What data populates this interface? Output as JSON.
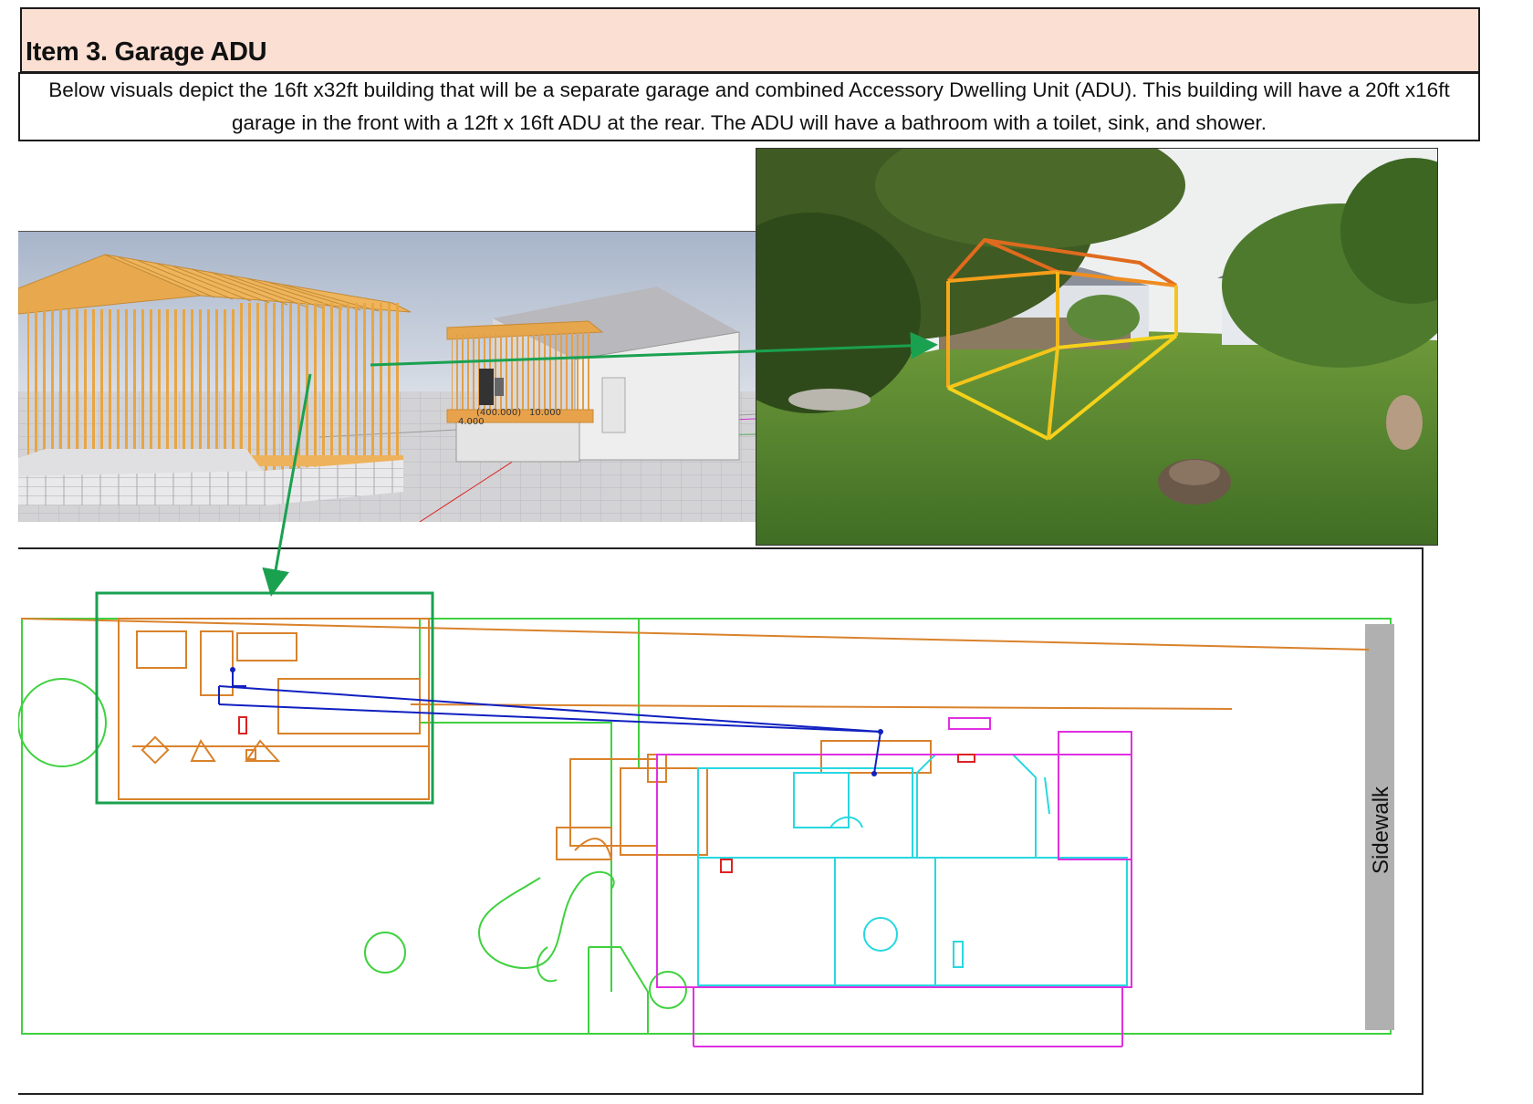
{
  "header": {
    "title": "Item 3. Garage ADU",
    "description": "Below visuals depict the 16ft x32ft  building that will be a separate garage and combined Accessory Dwelling Unit (ADU). This building will have a 20ft x16ft garage in the front with a 12ft x 16ft ADU at the rear. The ADU will have a bathroom with a toilet, sink, and shower."
  },
  "render_labels": {
    "dim1": "4.000",
    "dim2": "(400.000)",
    "dim3": "10.000"
  },
  "site_plan": {
    "sidewalk_label": "Sidewalk"
  },
  "colors": {
    "title_bg": "#fbdfd3",
    "pointer_arrow": "#1aa150",
    "frame_wood": "#e8a445",
    "outline_orange": "#d97a2b",
    "outline_yellow": "#f5d21a",
    "plan_green": "#3fd13f",
    "plan_orange": "#d9822b",
    "plan_cyan": "#27d8e0",
    "plan_magenta": "#e030e0",
    "plan_blue": "#1020c0",
    "sidewalk_gray": "#b0b0b0"
  }
}
